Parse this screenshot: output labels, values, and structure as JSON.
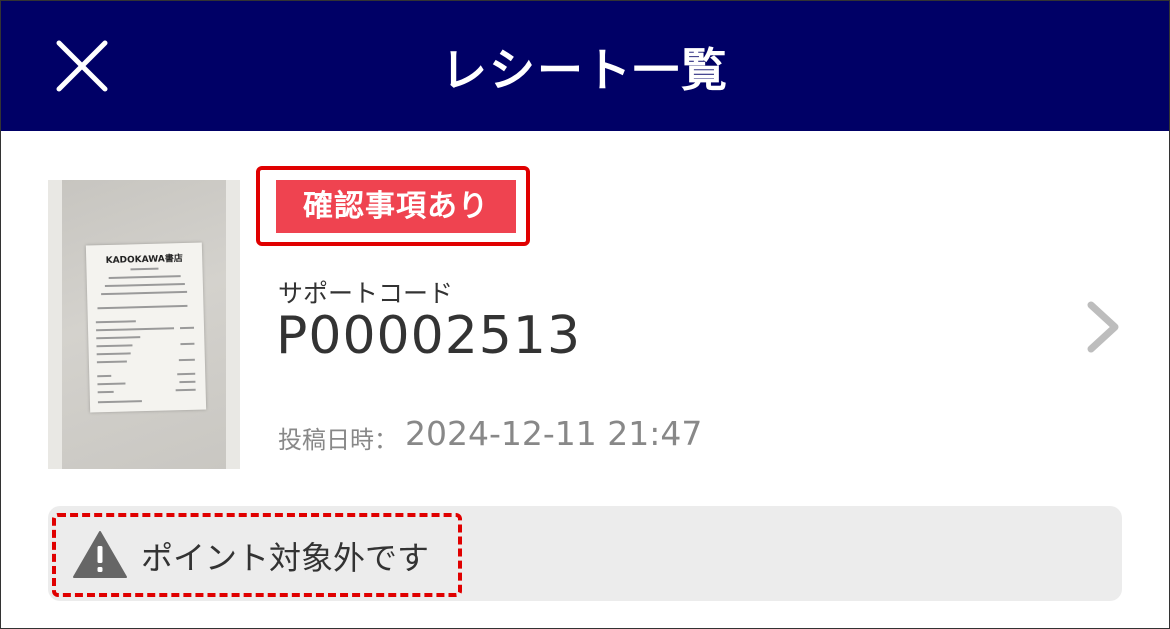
{
  "header": {
    "title": "レシート一覧",
    "background_color": "#000066",
    "close_icon": "close-icon"
  },
  "receipt": {
    "thumbnail_shop_text": "KADOKAWA書店",
    "status_badge": "確認事項あり",
    "status_color": "#ef4350",
    "support_code_label": "サポートコード",
    "support_code": "P00002513",
    "posted_label": "投稿日時：",
    "posted_datetime": "2024-12-11 21:47",
    "detail_icon": "chevron-right-icon"
  },
  "notice": {
    "icon": "warning-icon",
    "text": "ポイント対象外です"
  },
  "annotation_color": "#e00000"
}
